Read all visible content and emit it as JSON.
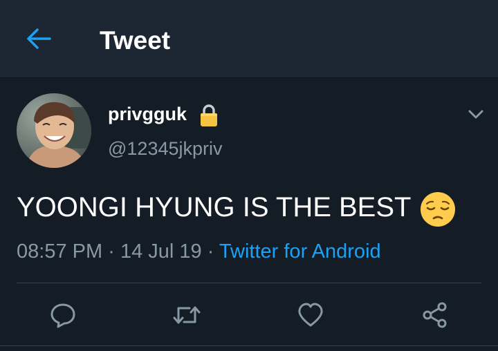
{
  "header": {
    "title": "Tweet",
    "back_icon": "arrow-left-icon"
  },
  "tweet": {
    "display_name": "privgguk",
    "handle": "@12345jkpriv",
    "protected_icon": "lock-icon",
    "text": "YOONGI HYUNG IS THE BEST",
    "emoji": "pensive-face-emoji",
    "time": "08:57 PM",
    "date": "14 Jul 19",
    "separator": "·",
    "source": "Twitter for Android"
  },
  "actions": {
    "reply_icon": "reply-icon",
    "retweet_icon": "retweet-icon",
    "like_icon": "heart-icon",
    "share_icon": "share-icon"
  },
  "colors": {
    "background": "#141d26",
    "header_background": "#1c2733",
    "accent": "#1da1f2",
    "secondary_text": "#8899a6",
    "lock": "#f5c542"
  }
}
